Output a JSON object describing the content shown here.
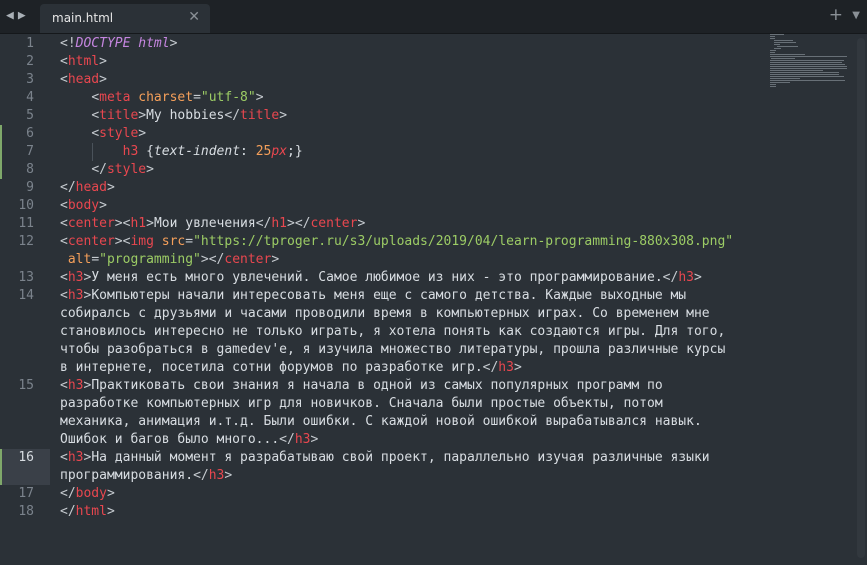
{
  "tabs": [
    {
      "label": "main.html"
    }
  ],
  "icons": {
    "back": "◀",
    "forward": "▶",
    "close": "✕",
    "new_tab": "+",
    "tab_menu": "▼"
  },
  "colors": {
    "background": "#2b3137",
    "tag": "#e8474f",
    "attribute": "#f49f5a",
    "string": "#9ccc65",
    "text": "#d8dde2",
    "line_number": "#7b838c",
    "modified_marker": "#7fa86a"
  },
  "editor": {
    "current_line": 16,
    "modified_lines": [
      6,
      7,
      8,
      16
    ],
    "lines": [
      {
        "n": "1",
        "segs": [
          [
            "br",
            "<!"
          ],
          [
            "kw",
            "DOCTYPE"
          ],
          [
            "txt",
            " "
          ],
          [
            "kw",
            "html"
          ],
          [
            "br",
            ">"
          ]
        ]
      },
      {
        "n": "2",
        "segs": [
          [
            "br",
            "<"
          ],
          [
            "tag",
            "html"
          ],
          [
            "br",
            ">"
          ]
        ]
      },
      {
        "n": "3",
        "segs": [
          [
            "br",
            "<"
          ],
          [
            "tag",
            "head"
          ],
          [
            "br",
            ">"
          ]
        ]
      },
      {
        "n": "4",
        "segs": [
          [
            "txt",
            "    "
          ],
          [
            "br",
            "<"
          ],
          [
            "tag",
            "meta"
          ],
          [
            "txt",
            " "
          ],
          [
            "attr",
            "charset"
          ],
          [
            "br",
            "="
          ],
          [
            "str",
            "\"utf-8\""
          ],
          [
            "br",
            ">"
          ]
        ]
      },
      {
        "n": "5",
        "segs": [
          [
            "txt",
            "    "
          ],
          [
            "br",
            "<"
          ],
          [
            "tag",
            "title"
          ],
          [
            "br",
            ">"
          ],
          [
            "txt",
            "My hobbies"
          ],
          [
            "br",
            "</"
          ],
          [
            "tag",
            "title"
          ],
          [
            "br",
            ">"
          ]
        ]
      },
      {
        "n": "6",
        "segs": [
          [
            "txt",
            "    "
          ],
          [
            "br",
            "<"
          ],
          [
            "tag",
            "style"
          ],
          [
            "br",
            ">"
          ]
        ]
      },
      {
        "n": "7",
        "segs": [
          [
            "txt",
            "        "
          ],
          [
            "tag",
            "h3"
          ],
          [
            "txt",
            " {"
          ],
          [
            "prop",
            "text-indent"
          ],
          [
            "txt",
            ": "
          ],
          [
            "num",
            "25"
          ],
          [
            "unit",
            "px"
          ],
          [
            "txt",
            ";}"
          ]
        ]
      },
      {
        "n": "8",
        "segs": [
          [
            "txt",
            "    "
          ],
          [
            "br",
            "</"
          ],
          [
            "tag",
            "style"
          ],
          [
            "br",
            ">"
          ]
        ]
      },
      {
        "n": "9",
        "segs": [
          [
            "br",
            "</"
          ],
          [
            "tag",
            "head"
          ],
          [
            "br",
            ">"
          ]
        ]
      },
      {
        "n": "10",
        "segs": [
          [
            "br",
            "<"
          ],
          [
            "tag",
            "body"
          ],
          [
            "br",
            ">"
          ]
        ]
      },
      {
        "n": "11",
        "segs": [
          [
            "br",
            "<"
          ],
          [
            "tag",
            "center"
          ],
          [
            "br",
            "><"
          ],
          [
            "tag",
            "h1"
          ],
          [
            "br",
            ">"
          ],
          [
            "txt",
            "Мои увлечения"
          ],
          [
            "br",
            "</"
          ],
          [
            "tag",
            "h1"
          ],
          [
            "br",
            "></"
          ],
          [
            "tag",
            "center"
          ],
          [
            "br",
            ">"
          ]
        ]
      },
      {
        "n": "12",
        "segs": [
          [
            "br",
            "<"
          ],
          [
            "tag",
            "center"
          ],
          [
            "br",
            "><"
          ],
          [
            "tag",
            "img"
          ],
          [
            "txt",
            " "
          ],
          [
            "attr",
            "src"
          ],
          [
            "br",
            "="
          ],
          [
            "str",
            "\"https://tproger.ru/s3/uploads/2019/04/learn-programming-880x308.png\""
          ]
        ]
      },
      {
        "n": "",
        "segs": [
          [
            "txt",
            " "
          ],
          [
            "attr",
            "alt"
          ],
          [
            "br",
            "="
          ],
          [
            "str",
            "\"programming\""
          ],
          [
            "br",
            "></"
          ],
          [
            "tag",
            "center"
          ],
          [
            "br",
            ">"
          ]
        ]
      },
      {
        "n": "13",
        "segs": [
          [
            "br",
            "<"
          ],
          [
            "tag",
            "h3"
          ],
          [
            "br",
            ">"
          ],
          [
            "txt",
            "У меня есть много увлечений. Самое любимое из них - это программирование."
          ],
          [
            "br",
            "</"
          ],
          [
            "tag",
            "h3"
          ],
          [
            "br",
            ">"
          ]
        ]
      },
      {
        "n": "14",
        "segs": [
          [
            "br",
            "<"
          ],
          [
            "tag",
            "h3"
          ],
          [
            "br",
            ">"
          ],
          [
            "txt",
            "Компьютеры начали интересовать меня еще с самого детства. Каждые выходные мы"
          ]
        ]
      },
      {
        "n": "",
        "segs": [
          [
            "txt",
            "собиралсь с друзьями и часами проводили время в компьютерных играх. Со временем мне"
          ]
        ]
      },
      {
        "n": "",
        "segs": [
          [
            "txt",
            "становилось интересно не только играть, я хотела понять как создаются игры. Для того,"
          ]
        ]
      },
      {
        "n": "",
        "segs": [
          [
            "txt",
            "чтобы разобраться в gamedev'е, я изучила множество литературы, прошла различные курсы"
          ]
        ]
      },
      {
        "n": "",
        "segs": [
          [
            "txt",
            "в интернете, посетила сотни форумов по разработке игр."
          ],
          [
            "br",
            "</"
          ],
          [
            "tag",
            "h3"
          ],
          [
            "br",
            ">"
          ]
        ]
      },
      {
        "n": "15",
        "segs": [
          [
            "br",
            "<"
          ],
          [
            "tag",
            "h3"
          ],
          [
            "br",
            ">"
          ],
          [
            "txt",
            "Практиковать свои знания я начала в одной из самых популярных программ по"
          ]
        ]
      },
      {
        "n": "",
        "segs": [
          [
            "txt",
            "разработке компьютерных игр для новичков. Сначала были простые объекты, потом"
          ]
        ]
      },
      {
        "n": "",
        "segs": [
          [
            "txt",
            "механика, анимация и.т.д. Были ошибки. С каждой новой ошибкой вырабатывался навык."
          ]
        ]
      },
      {
        "n": "",
        "segs": [
          [
            "txt",
            "Ошибок и багов было много..."
          ],
          [
            "br",
            "</"
          ],
          [
            "tag",
            "h3"
          ],
          [
            "br",
            ">"
          ]
        ]
      },
      {
        "n": "16",
        "segs": [
          [
            "br",
            "<"
          ],
          [
            "tag",
            "h3"
          ],
          [
            "br",
            ">"
          ],
          [
            "txt",
            "На данный момент я разрабатываю свой проект, параллельно изучая различные языки"
          ]
        ]
      },
      {
        "n": "",
        "segs": [
          [
            "txt",
            "программирования."
          ],
          [
            "br",
            "</"
          ],
          [
            "tag",
            "h3"
          ],
          [
            "br",
            ">"
          ]
        ]
      },
      {
        "n": "17",
        "segs": [
          [
            "br",
            "</"
          ],
          [
            "tag",
            "body"
          ],
          [
            "br",
            ">"
          ]
        ]
      },
      {
        "n": "18",
        "segs": [
          [
            "br",
            "</"
          ],
          [
            "tag",
            "html"
          ],
          [
            "br",
            ">"
          ]
        ]
      }
    ]
  }
}
